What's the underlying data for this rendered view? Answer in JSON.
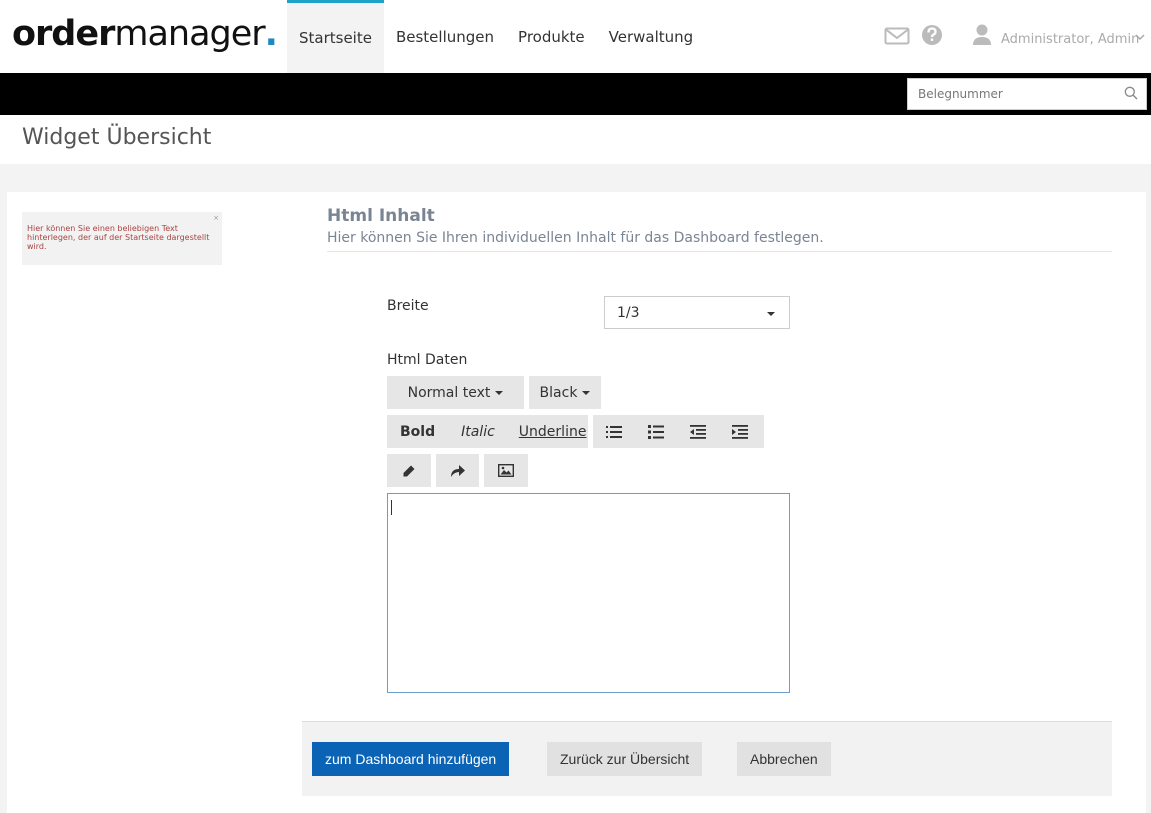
{
  "logo": {
    "part1": "order",
    "part2": "manager",
    "dot": "."
  },
  "nav": {
    "items": [
      "Startseite",
      "Bestellungen",
      "Produkte",
      "Verwaltung"
    ],
    "active": "Startseite"
  },
  "user": {
    "name": "Administrator, Admin"
  },
  "search": {
    "placeholder": "Belegnummer"
  },
  "page": {
    "title": "Widget Übersicht"
  },
  "preview": {
    "text": "Hier können Sie einen beliebigen Text hinterlegen, der auf der Startseite dargestellt wird.",
    "close": "×"
  },
  "section": {
    "title": "Html Inhalt",
    "subtitle": "Hier können Sie Ihren individuellen Inhalt für das Dashboard festlegen."
  },
  "form": {
    "width_label": "Breite",
    "width_value": "1/3",
    "html_label": "Html Daten"
  },
  "editor_toolbar": {
    "text_style": "Normal text",
    "color": "Black",
    "bold": "Bold",
    "italic": "Italic",
    "underline": "Underline"
  },
  "footer": {
    "add": "zum Dashboard hinzufügen",
    "back": "Zurück zur Übersicht",
    "cancel": "Abbrechen"
  },
  "colors": {
    "accent": "#1fa2c8",
    "primary_button": "#0b63b5",
    "logo_dot": "#1f87c4",
    "preview_text": "#a94442"
  }
}
